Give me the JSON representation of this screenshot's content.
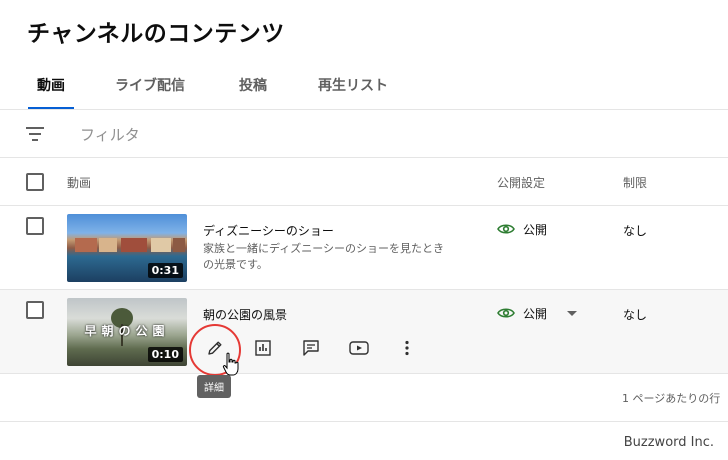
{
  "page": {
    "title": "チャンネルのコンテンツ"
  },
  "tabs": [
    {
      "label": "動画",
      "active": true
    },
    {
      "label": "ライブ配信",
      "active": false
    },
    {
      "label": "投稿",
      "active": false
    },
    {
      "label": "再生リスト",
      "active": false
    }
  ],
  "filter": {
    "label": "フィルタ",
    "icon": "filter-icon"
  },
  "table": {
    "headers": {
      "video": "動画",
      "visibility": "公開設定",
      "restriction": "制限"
    },
    "rows": [
      {
        "title": "ディズニーシーのショー",
        "description": "家族と一緒にディズニーシーのショーを見たときの光景です。",
        "duration": "0:31",
        "visibility": "公開",
        "restriction": "なし"
      },
      {
        "title": "朝の公園の風景",
        "thumbnail_text": "早朝の公園",
        "duration": "0:10",
        "visibility": "公開",
        "restriction": "なし",
        "actions": [
          "pencil-icon",
          "analytics-icon",
          "comments-icon",
          "youtube-icon",
          "more-vert-icon"
        ],
        "tooltip": "詳細"
      }
    ]
  },
  "pager": {
    "text": "1 ページあたりの行"
  },
  "watermark": "Buzzword Inc.",
  "colors": {
    "accent": "#065fd4",
    "public": "#2e7d32",
    "highlight": "#e53935"
  }
}
